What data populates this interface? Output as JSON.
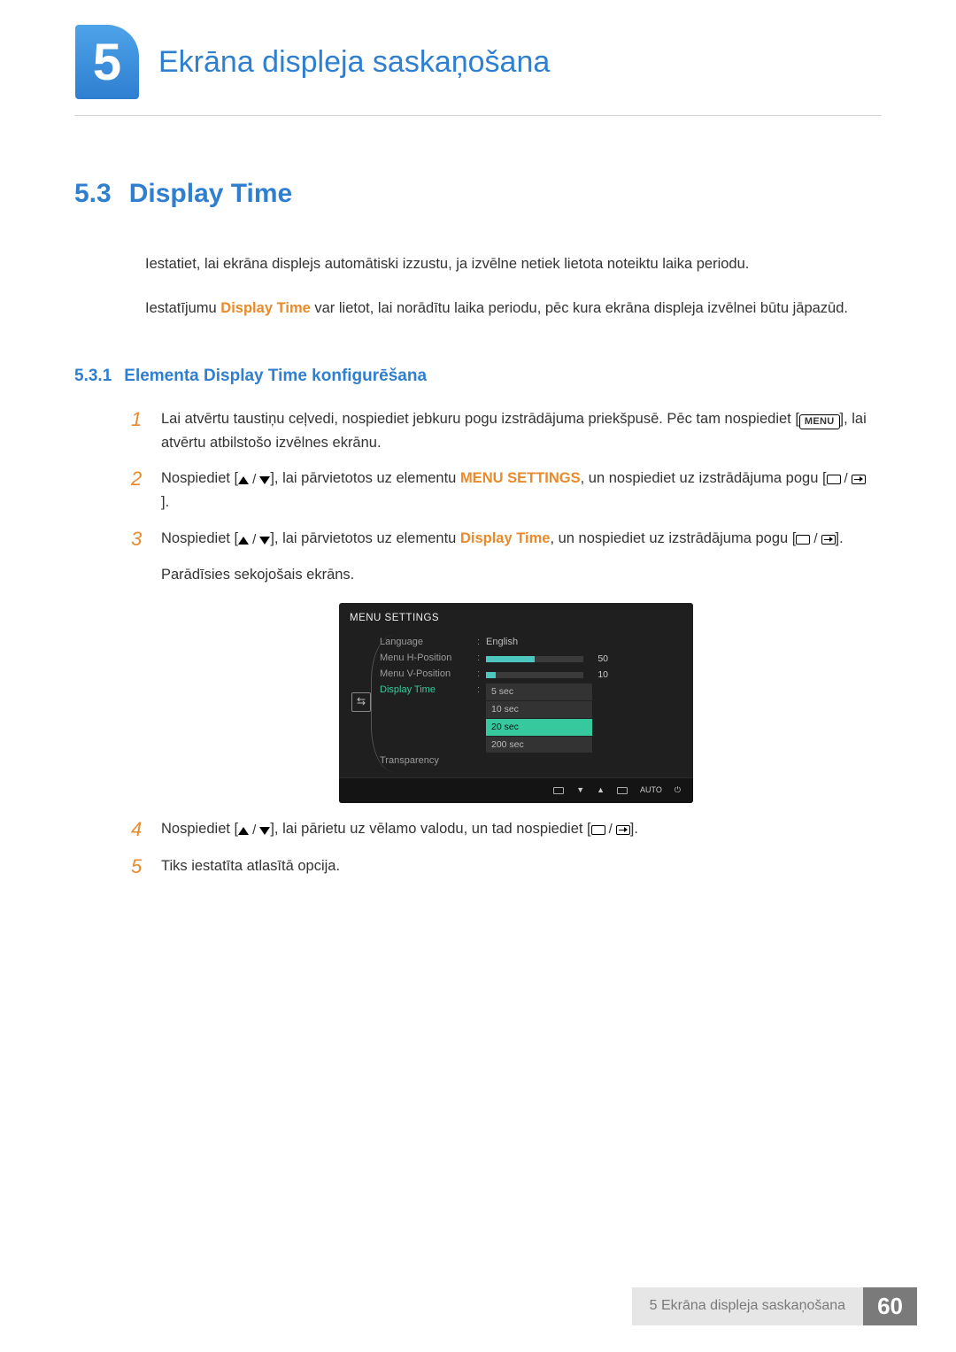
{
  "chapter": {
    "number": "5",
    "title": "Ekrāna displeja saskaņošana"
  },
  "section": {
    "number": "5.3",
    "title": "Display Time"
  },
  "intro": {
    "p1": "Iestatiet, lai ekrāna displejs automātiski izzustu, ja izvēlne netiek lietota noteiktu laika periodu.",
    "p2a": "Iestatījumu ",
    "p2_bold": "Display Time",
    "p2b": " var lietot, lai norādītu laika periodu, pēc kura ekrāna displeja izvēlnei būtu jāpazūd."
  },
  "subsection": {
    "number": "5.3.1",
    "title": "Elementa Display Time konfigurēšana"
  },
  "steps": {
    "s1a": "Lai atvērtu taustiņu ceļvedi, nospiediet jebkuru pogu izstrādājuma priekšpusē. Pēc tam nospiediet [",
    "s1_menu": "MENU",
    "s1b": "], lai atvērtu atbilstošo izvēlnes ekrānu.",
    "s2a": "Nospiediet [",
    "s2b": "], lai pārvietotos uz elementu ",
    "s2_bold": "MENU SETTINGS",
    "s2c": ", un nospiediet uz izstrādājuma pogu [",
    "s2d": "].",
    "s3a": "Nospiediet [",
    "s3b": "], lai pārvietotos uz elementu ",
    "s3_bold": "Display Time",
    "s3c": ", un nospiediet uz izstrādājuma pogu [",
    "s3d": "].",
    "s3e": "Parādīsies sekojošais ekrāns.",
    "s4a": "Nospiediet [",
    "s4b": "], lai pārietu uz vēlamo valodu, un tad nospiediet [",
    "s4c": "].",
    "s5": "Tiks iestatīta atlasītā opcija."
  },
  "osd": {
    "title": "MENU SETTINGS",
    "rows": {
      "language": {
        "label": "Language",
        "value": "English"
      },
      "hpos": {
        "label": "Menu H-Position",
        "value": "50",
        "pct": 50
      },
      "vpos": {
        "label": "Menu V-Position",
        "value": "10",
        "pct": 10
      },
      "dtime": {
        "label": "Display Time"
      },
      "transp": {
        "label": "Transparency"
      }
    },
    "options": [
      "5 sec",
      "10 sec",
      "20 sec",
      "200 sec"
    ],
    "selected": "20 sec",
    "footer_auto": "AUTO"
  },
  "footer": {
    "label": "5 Ekrāna displeja saskaņošana",
    "page": "60"
  }
}
